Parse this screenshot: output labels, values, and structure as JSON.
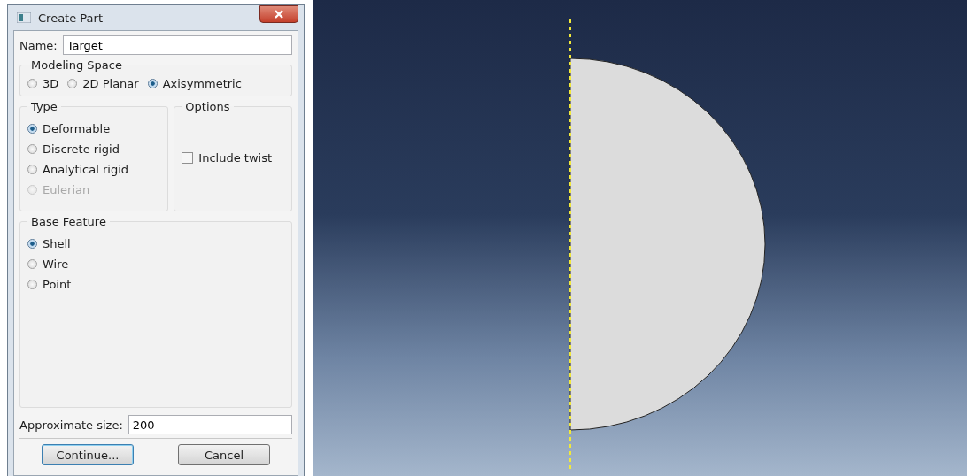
{
  "window": {
    "title": "Create Part"
  },
  "name_field": {
    "label": "Name:",
    "value": "Target"
  },
  "modeling_space": {
    "title": "Modeling Space",
    "options": [
      {
        "label": "3D",
        "selected": false
      },
      {
        "label": "2D Planar",
        "selected": false
      },
      {
        "label": "Axisymmetric",
        "selected": true
      }
    ]
  },
  "type": {
    "title": "Type",
    "options": [
      {
        "label": "Deformable",
        "selected": true,
        "disabled": false
      },
      {
        "label": "Discrete rigid",
        "selected": false,
        "disabled": false
      },
      {
        "label": "Analytical rigid",
        "selected": false,
        "disabled": false
      },
      {
        "label": "Eulerian",
        "selected": false,
        "disabled": true
      }
    ]
  },
  "options": {
    "title": "Options",
    "checkbox": {
      "label": "Include twist",
      "checked": false
    }
  },
  "base_feature": {
    "title": "Base Feature",
    "options": [
      {
        "label": "Shell",
        "selected": true
      },
      {
        "label": "Wire",
        "selected": false
      },
      {
        "label": "Point",
        "selected": false
      }
    ]
  },
  "approximate_size": {
    "label": "Approximate size:",
    "value": "200"
  },
  "buttons": [
    {
      "label": "Continue...",
      "kind": "default"
    },
    {
      "label": "Cancel",
      "kind": "normal"
    }
  ]
}
